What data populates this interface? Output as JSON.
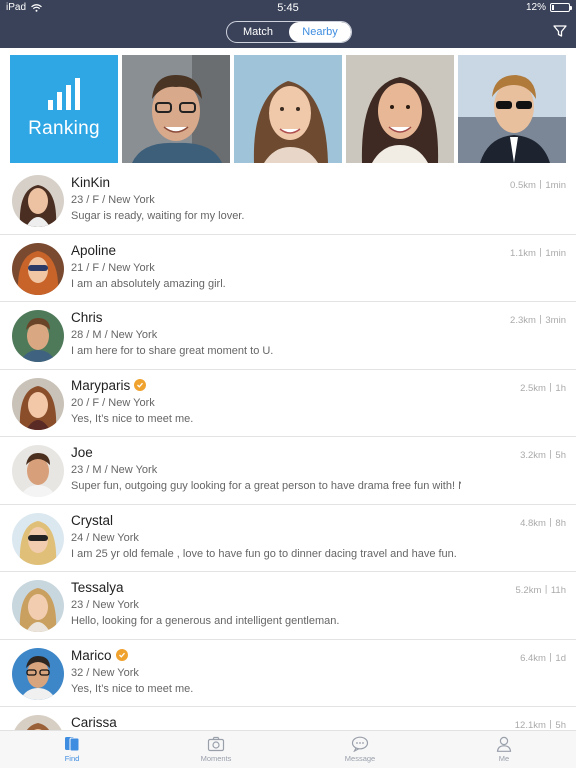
{
  "status": {
    "device": "iPad",
    "time": "5:45",
    "battery": "12%",
    "battery_level": 0.12
  },
  "nav": {
    "tabs": [
      {
        "label": "Match",
        "active": false
      },
      {
        "label": "Nearby",
        "active": true
      }
    ],
    "filter_icon": "filter-icon"
  },
  "gallery": {
    "ranking_label": "Ranking",
    "ranking_icon": "bar-chart-icon",
    "accent": "#2fa7e5"
  },
  "users": [
    {
      "name": "KinKin",
      "meta": "23 / F / New York",
      "bio": "Sugar is ready, waiting for my lover.",
      "distance": "0.5km丨1min",
      "verified": false
    },
    {
      "name": "Apoline",
      "meta": "21 / F / New York",
      "bio": "I am an absolutely amazing girl.",
      "distance": "1.1km丨1min",
      "verified": false
    },
    {
      "name": "Chris",
      "meta": "28 / M / New York",
      "bio": "I am here for to share great moment to U.",
      "distance": "2.3km丨3min",
      "verified": false
    },
    {
      "name": "Maryparis",
      "meta": "20 / F / New York",
      "bio": "Yes, It’s nice to meet me.",
      "distance": "2.5km丨1h",
      "verified": true
    },
    {
      "name": "Joe",
      "meta": "23 / M / New York",
      "bio": "Super fun, outgoing guy looking for a great person to have drama free fun with! No....",
      "distance": "3.2km丨5h",
      "verified": false
    },
    {
      "name": "Crystal",
      "meta": "24 / New York",
      "bio": "I am 25 yr old female , love to have fun go to dinner dacing travel and have fun.",
      "distance": "4.8km丨8h",
      "verified": false
    },
    {
      "name": "Tessalya",
      "meta": "23 / New York",
      "bio": "Hello, looking for a generous and intelligent gentleman.",
      "distance": "5.2km丨11h",
      "verified": false
    },
    {
      "name": "Marico",
      "meta": "32 / New York",
      "bio": "Yes, It’s nice to meet me.",
      "distance": "6.4km丨1d",
      "verified": true
    },
    {
      "name": "Carissa",
      "meta": "",
      "bio": "",
      "distance": "12.1km丨5h",
      "verified": false
    }
  ],
  "tabbar": [
    {
      "label": "Find",
      "icon": "find-icon",
      "active": true
    },
    {
      "label": "Moments",
      "icon": "camera-icon",
      "active": false
    },
    {
      "label": "Message",
      "icon": "chat-bubble-icon",
      "active": false
    },
    {
      "label": "Me",
      "icon": "person-icon",
      "active": false
    }
  ],
  "colors": {
    "header_bg": "#3a4259",
    "active_blue": "#3e8de0",
    "verified_orange": "#f0a22e"
  }
}
